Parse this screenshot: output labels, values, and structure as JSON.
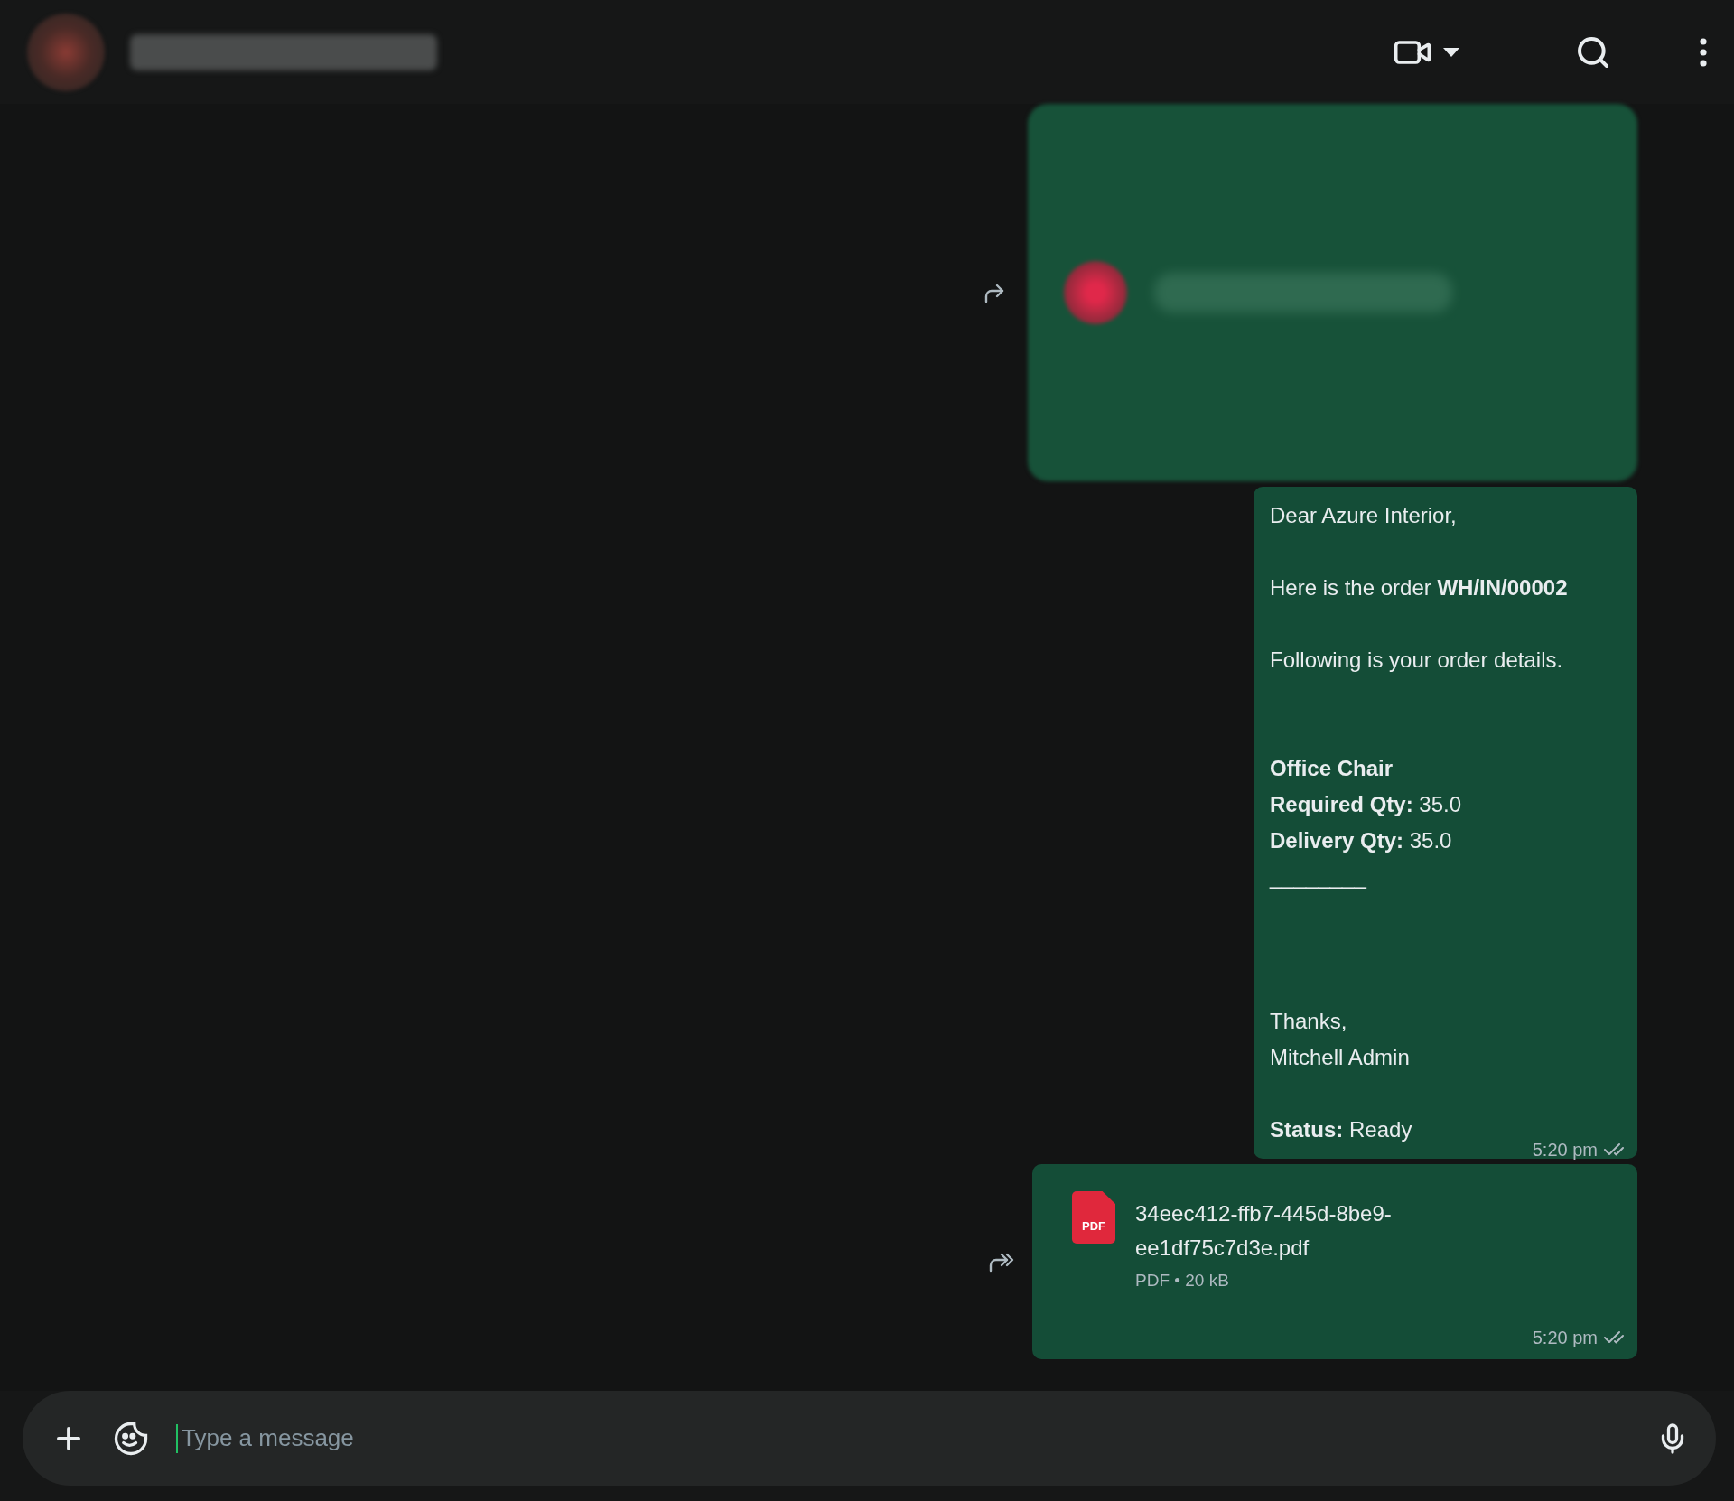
{
  "messages": [
    {
      "kind": "blurred"
    },
    {
      "kind": "text",
      "paragraphs": [
        [
          "Dear Azure Interior,"
        ],
        [
          "Here is the order **WH/IN/00002**"
        ],
        [
          "Following is your order details."
        ],
        [
          "**Office Chair**",
          "**Required Qty:** 35.0",
          "**Delivery Qty:** 35.0",
          "________"
        ],
        [
          "Thanks,",
          "Mitchell Admin"
        ],
        [
          "**Status:** Ready"
        ]
      ],
      "time": "5:20 pm",
      "read": false
    },
    {
      "kind": "file",
      "file": {
        "badge": "PDF",
        "name": "34eec412-ffb7-445d-8be9-ee1df75c7d3e.pdf",
        "format": "PDF",
        "separator": "•",
        "size": "20 kB"
      },
      "time": "5:20 pm",
      "read": false
    }
  ],
  "composer": {
    "placeholder": "Type a message"
  }
}
